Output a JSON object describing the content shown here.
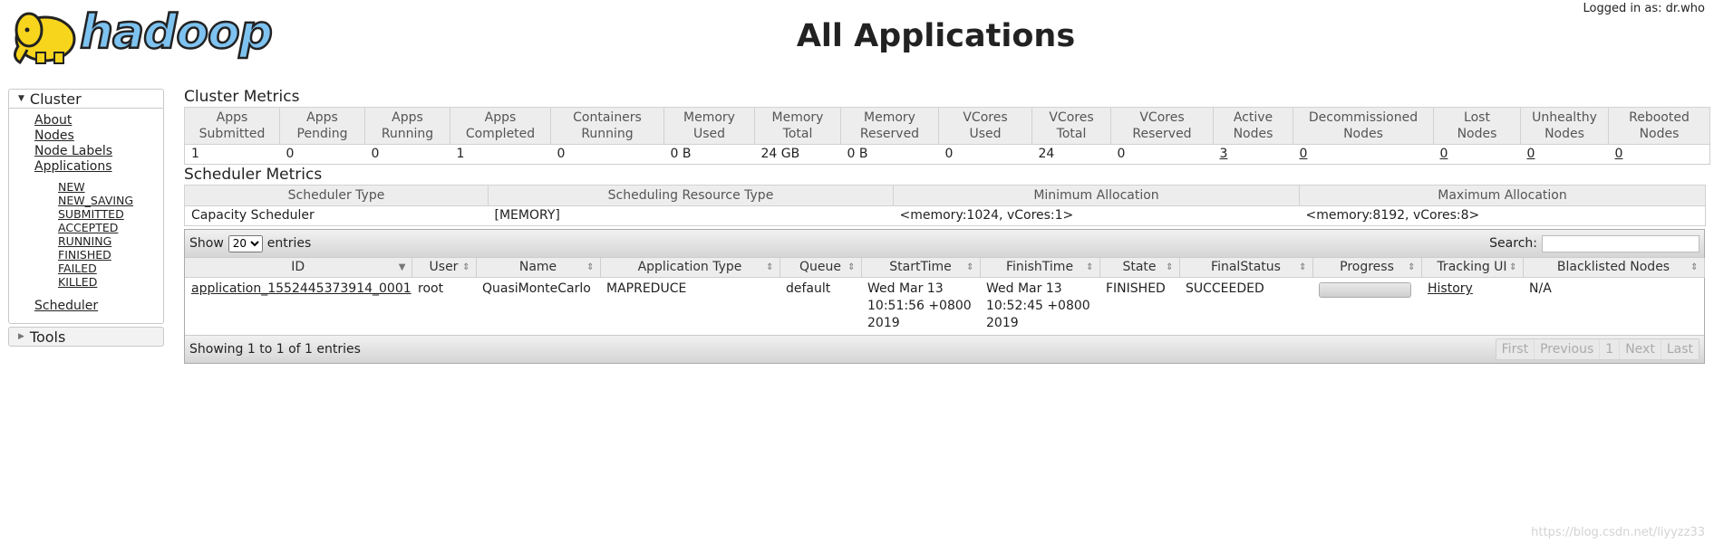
{
  "header": {
    "title": "All Applications",
    "logged_in": "Logged in as: dr.who",
    "logo_text": "hadoop"
  },
  "sidebar": {
    "cluster_label": "Cluster",
    "items": [
      "About",
      "Nodes",
      "Node Labels",
      "Applications"
    ],
    "app_states": [
      "NEW",
      "NEW_SAVING",
      "SUBMITTED",
      "ACCEPTED",
      "RUNNING",
      "FINISHED",
      "FAILED",
      "KILLED"
    ],
    "scheduler_label": "Scheduler",
    "tools_label": "Tools"
  },
  "cluster_metrics": {
    "title": "Cluster Metrics",
    "headers": [
      [
        "Apps",
        "Submitted"
      ],
      [
        "Apps",
        "Pending"
      ],
      [
        "Apps",
        "Running"
      ],
      [
        "Apps",
        "Completed"
      ],
      [
        "Containers",
        "Running"
      ],
      [
        "Memory",
        "Used"
      ],
      [
        "Memory",
        "Total"
      ],
      [
        "Memory",
        "Reserved"
      ],
      [
        "VCores",
        "Used"
      ],
      [
        "VCores",
        "Total"
      ],
      [
        "VCores",
        "Reserved"
      ],
      [
        "Active",
        "Nodes"
      ],
      [
        "Decommissioned",
        "Nodes"
      ],
      [
        "Lost",
        "Nodes"
      ],
      [
        "Unhealthy",
        "Nodes"
      ],
      [
        "Rebooted",
        "Nodes"
      ]
    ],
    "values": [
      "1",
      "0",
      "0",
      "1",
      "0",
      "0 B",
      "24 GB",
      "0 B",
      "0",
      "24",
      "0",
      "3",
      "0",
      "0",
      "0",
      "0"
    ]
  },
  "scheduler_metrics": {
    "title": "Scheduler Metrics",
    "headers": [
      "Scheduler Type",
      "Scheduling Resource Type",
      "Minimum Allocation",
      "Maximum Allocation"
    ],
    "values": [
      "Capacity Scheduler",
      "[MEMORY]",
      "<memory:1024, vCores:1>",
      "<memory:8192, vCores:8>"
    ]
  },
  "applications": {
    "show_label": "Show",
    "entries_label": "entries",
    "page_size": "20",
    "search_label": "Search:",
    "columns": [
      "ID",
      "User",
      "Name",
      "Application Type",
      "Queue",
      "StartTime",
      "FinishTime",
      "State",
      "FinalStatus",
      "Progress",
      "Tracking UI",
      "Blacklisted Nodes"
    ],
    "rows": [
      {
        "id": "application_1552445373914_0001",
        "user": "root",
        "name": "QuasiMonteCarlo",
        "type": "MAPREDUCE",
        "queue": "default",
        "start": "Wed Mar 13 10:51:56 +0800 2019",
        "finish": "Wed Mar 13 10:52:45 +0800 2019",
        "state": "FINISHED",
        "final_status": "SUCCEEDED",
        "progress": 100,
        "tracking": "History",
        "blacklisted": "N/A"
      }
    ],
    "info": "Showing 1 to 1 of 1 entries",
    "pager": [
      "First",
      "Previous",
      "1",
      "Next",
      "Last"
    ]
  },
  "watermark": "https://blog.csdn.net/liyyzz33"
}
